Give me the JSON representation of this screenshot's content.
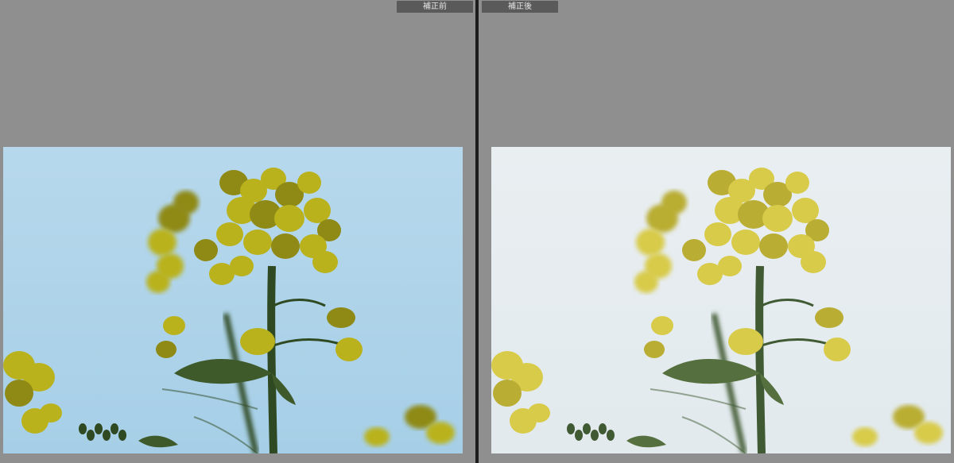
{
  "comparison": {
    "before": {
      "label": "補正前",
      "colors": {
        "sky_top": "#b7d8ec",
        "sky_bottom": "#a6cfe7",
        "flower": "#b9b21c",
        "flower_shadow": "#8f8a16",
        "stem": "#2f4a22",
        "leaf": "#3f5a2a"
      }
    },
    "after": {
      "label": "補正後",
      "colors": {
        "sky_top": "#e9eef1",
        "sky_bottom": "#e2eaee",
        "flower": "#d8cb4a",
        "flower_shadow": "#b9ad33",
        "stem": "#405a33",
        "leaf": "#55703e"
      }
    }
  }
}
